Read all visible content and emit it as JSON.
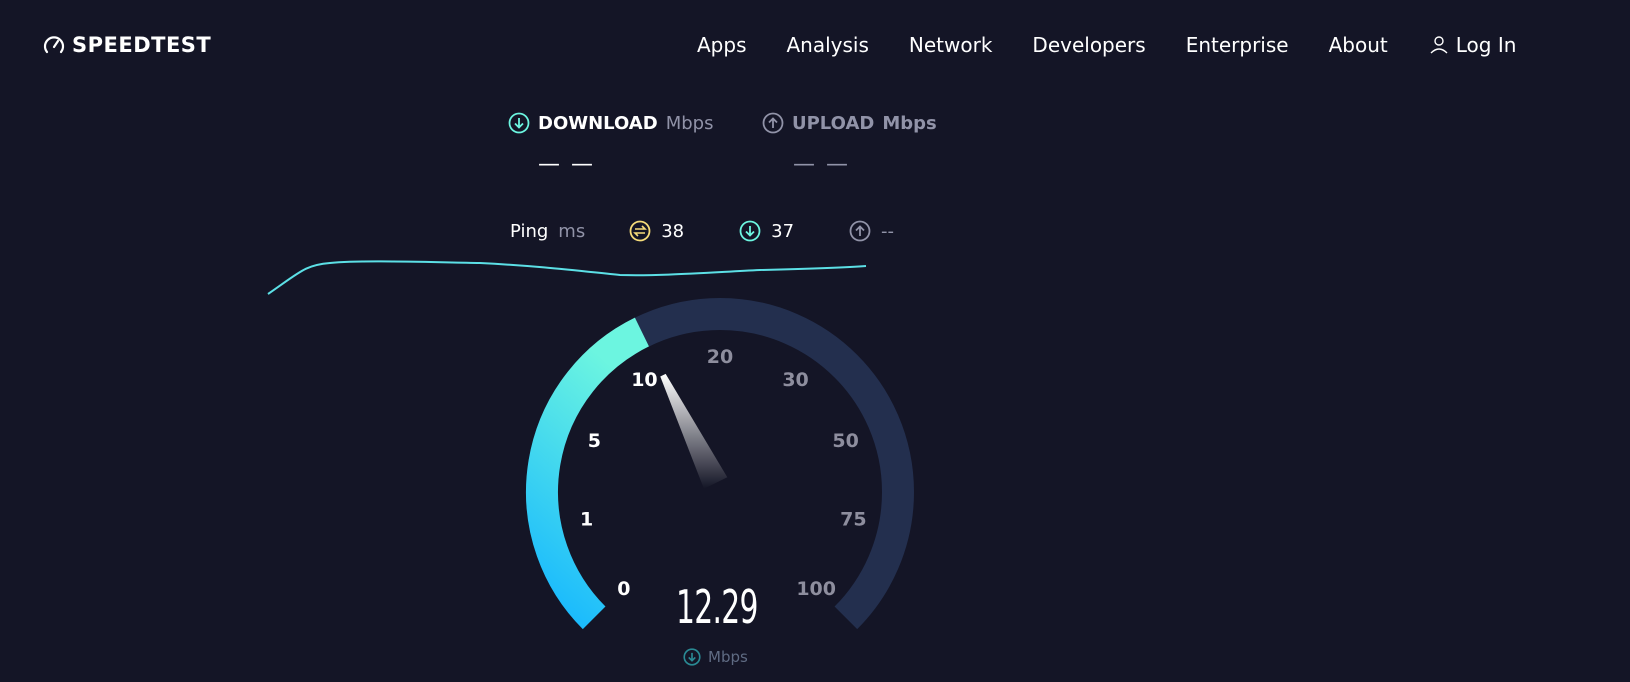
{
  "header": {
    "logo_text": "SPEEDTEST",
    "nav": [
      "Apps",
      "Analysis",
      "Network",
      "Developers",
      "Enterprise",
      "About"
    ],
    "login_label": "Log In"
  },
  "results": {
    "download_label": "DOWNLOAD",
    "download_unit": "Mbps",
    "download_value": "— —",
    "upload_label": "UPLOAD",
    "upload_unit": "Mbps",
    "upload_value": "— —"
  },
  "ping": {
    "label": "Ping",
    "unit": "ms",
    "idle": "38",
    "download": "37",
    "upload": "--"
  },
  "gauge": {
    "ticks": [
      "0",
      "1",
      "5",
      "10",
      "20",
      "30",
      "50",
      "75",
      "100"
    ],
    "current_value": "12.29",
    "unit": "Mbps",
    "colors": {
      "accent_start": "#14b6ff",
      "accent_end": "#6cf5e0",
      "track": "#232f4e"
    }
  }
}
